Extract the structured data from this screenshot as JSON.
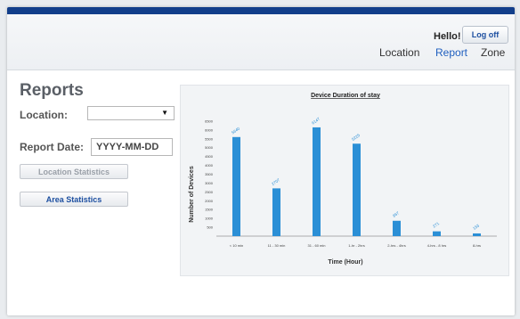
{
  "header": {
    "greeting": "Hello!",
    "logoff_label": "Log off",
    "nav": [
      {
        "label": "Location",
        "active": false
      },
      {
        "label": "Report",
        "active": true
      },
      {
        "label": "Zone",
        "active": false
      }
    ]
  },
  "sidebar": {
    "title": "Reports",
    "location_label": "Location:",
    "location_value": "",
    "report_date_label": "Report Date:",
    "report_date_placeholder": "YYYY-MM-DD",
    "location_stats_label": "Location Statistics",
    "area_stats_label": "Area Statistics"
  },
  "colors": {
    "brand_bar": "#123e8a",
    "bar_fill": "#2b8fd6",
    "link_blue": "#1f5fbf"
  },
  "chart_data": {
    "type": "bar",
    "title": "Device Duration of stay",
    "xlabel": "Time (Hour)",
    "ylabel": "Number of Devices",
    "categories": [
      "< 10 min",
      "11 - 30 min",
      "31 - 60 min",
      "1-hr - 2hrs",
      "2-hrs - 4hrs",
      "4-hrs - 8 hrs",
      "8-hrs"
    ],
    "values": [
      5600,
      2700,
      6147,
      5225,
      867,
      271,
      153
    ],
    "data_labels": [
      "5640",
      "2707",
      "6147",
      "5225",
      "867",
      "271",
      "153"
    ],
    "ylim": [
      0,
      7000
    ],
    "yticks": [
      500,
      1000,
      1500,
      2000,
      2500,
      3000,
      3500,
      4000,
      4500,
      5000,
      5500,
      6000,
      6500
    ]
  }
}
